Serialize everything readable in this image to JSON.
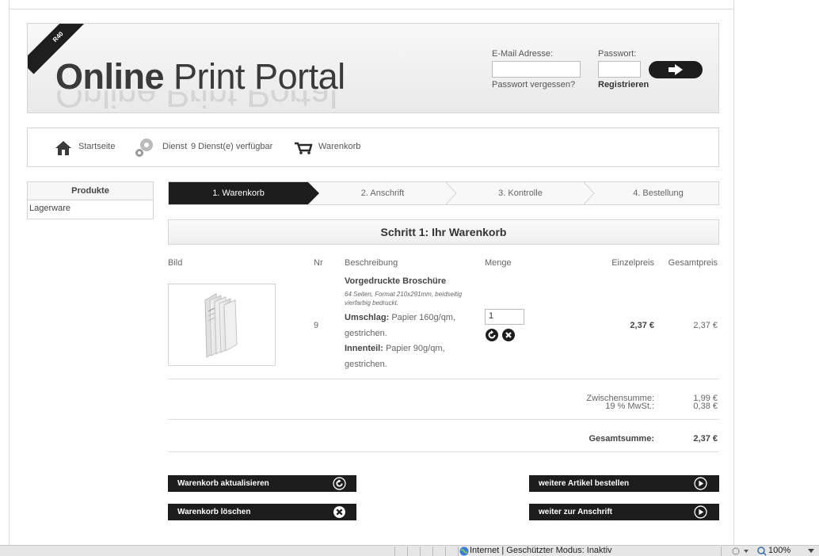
{
  "header": {
    "corner_badge": "R40",
    "logo_bold": "Online",
    "logo_rest": "Print Portal",
    "email_label": "E-Mail Adresse:",
    "password_label": "Passwort:",
    "forgot_link": "Passwort vergessen?",
    "register_link": "Registrieren"
  },
  "nav": {
    "home": "Startseite",
    "service": "Dienst",
    "service_count": "9 Dienst(e) verfügbar",
    "cart": "Warenkorb"
  },
  "sidebar": {
    "title": "Produkte",
    "items": [
      "Lagerware"
    ]
  },
  "steps": [
    "1. Warenkorb",
    "2. Anschrift",
    "3. Kontrolle",
    "4. Bestellung"
  ],
  "section_title": "Schritt 1: Ihr Warenkorb",
  "table": {
    "headers": {
      "image": "Bild",
      "nr": "Nr",
      "description": "Beschreibung",
      "quantity": "Menge",
      "unit_price": "Einzelpreis",
      "total_price": "Gesamtpreis"
    },
    "row": {
      "nr": "9",
      "title": "Vorgedruckte Broschüre",
      "subtitle": "64 Seiten, Format 210x291mm, beidseitig vierfarbig bedruckt.",
      "cover_label": "Umschlag:",
      "cover_value": "Papier 160g/qm,",
      "cover_value2": "gestrichen.",
      "inner_label": "Innenteil:",
      "inner_value": "Papier 90g/qm,",
      "inner_value2": "gestrichen.",
      "quantity": "1",
      "unit_price": "2,37 €",
      "total_price": "2,37 €"
    }
  },
  "summary": {
    "subtotal_label": "Zwischensumme:",
    "subtotal": "1,99 €",
    "vat_label": "19 % MwSt.:",
    "vat": "0,38 €",
    "total_label": "Gesamtsumme:",
    "total": "2,37 €"
  },
  "buttons": {
    "update_cart": "Warenkorb aktualisieren",
    "delete_cart": "Warenkorb löschen",
    "order_more": "weitere Artikel bestellen",
    "to_address": "weiter zur Anschrift"
  },
  "footer_text": "...",
  "statusbar": {
    "zone": "Internet | Geschützter Modus: Inaktiv",
    "zoom": "100%"
  }
}
